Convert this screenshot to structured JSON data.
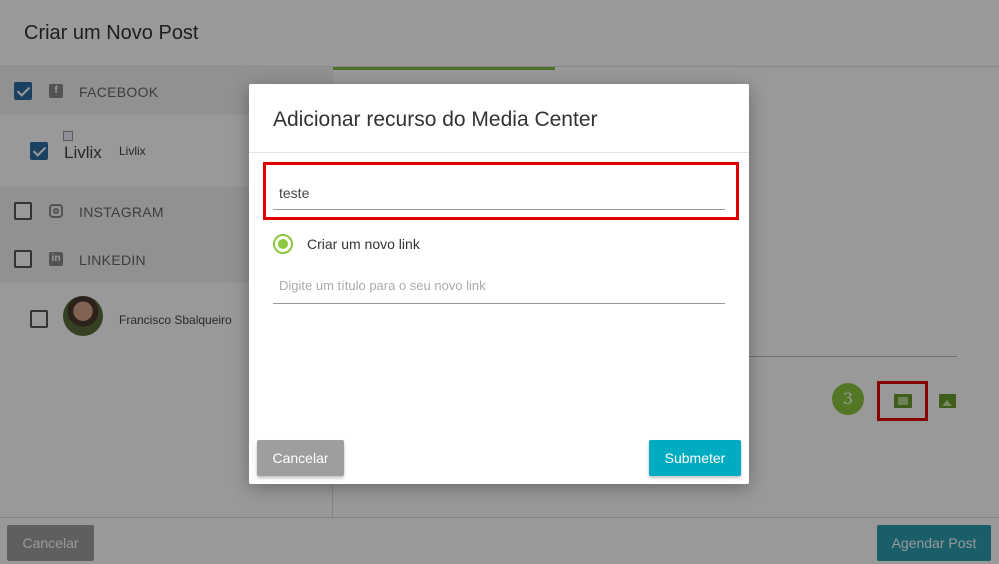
{
  "page": {
    "title": "Criar um Novo Post",
    "networks": [
      {
        "label": "FACEBOOK",
        "checked": true,
        "icon": "facebook-icon"
      },
      {
        "label": "INSTAGRAM",
        "checked": false,
        "icon": "instagram-icon"
      },
      {
        "label": "LINKEDIN",
        "checked": false,
        "icon": "linkedin-icon"
      }
    ],
    "accounts": [
      {
        "name": "Livlix",
        "checked": true,
        "avatar_alt": "Livlix"
      },
      {
        "name": "Francisco Sbalqueiro",
        "checked": false
      }
    ],
    "step_number": "3",
    "footer": {
      "cancel_label": "Cancelar",
      "schedule_label": "Agendar Post"
    }
  },
  "modal": {
    "title": "Adicionar recurso do Media Center",
    "search_value": "teste",
    "radio_label": "Criar um novo link",
    "radio_selected": true,
    "title_placeholder": "Digite um título para o seu novo link",
    "cancel_label": "Cancelar",
    "submit_label": "Submeter"
  },
  "colors": {
    "accent_green": "#8dc63f",
    "submit_teal": "#00acc1",
    "schedule_teal": "#2a9db0",
    "highlight_red": "#e00000",
    "checkbox_blue": "#2e6da4"
  }
}
